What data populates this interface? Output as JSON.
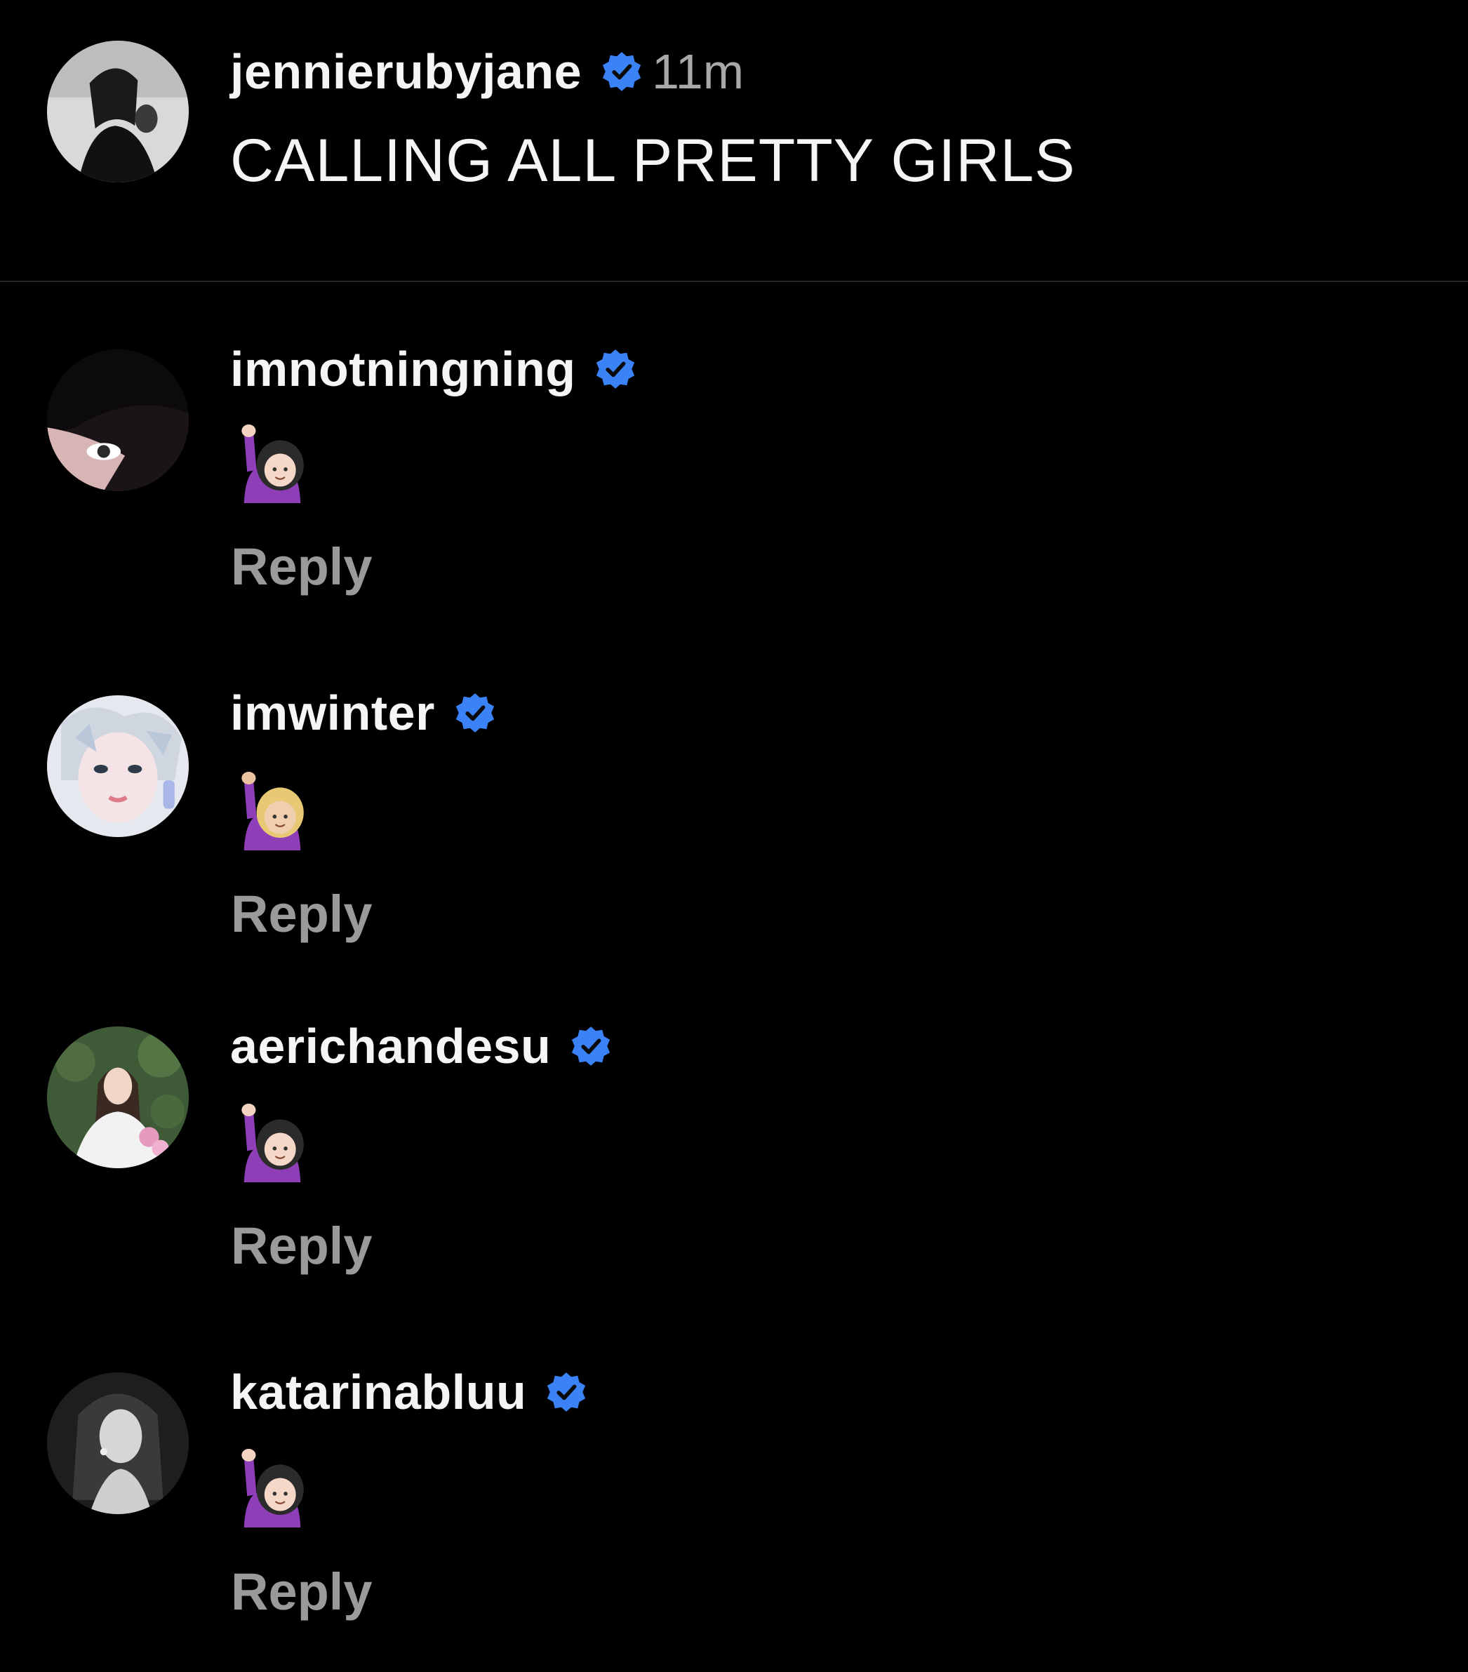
{
  "post": {
    "username": "jennierubyjane",
    "verified": true,
    "time": "11m",
    "caption": "CALLING ALL PRETTY GIRLS"
  },
  "comments": [
    {
      "username": "imnotningning",
      "verified": true,
      "emoji": "🙋🏻‍♀️",
      "emoji_icon": "woman-raising-hand-icon",
      "reply_label": "Reply"
    },
    {
      "username": "imwinter",
      "verified": true,
      "emoji": "🙋🏼‍♀️",
      "emoji_icon": "woman-raising-hand-icon",
      "reply_label": "Reply"
    },
    {
      "username": "aerichandesu",
      "verified": true,
      "emoji": "🙋🏻‍♀️",
      "emoji_icon": "woman-raising-hand-icon",
      "reply_label": "Reply"
    },
    {
      "username": "katarinabluu",
      "verified": true,
      "emoji": "🙋🏻‍♀️",
      "emoji_icon": "woman-raising-hand-icon",
      "reply_label": "Reply"
    }
  ],
  "colors": {
    "background": "#000000",
    "text": "#f5f5f5",
    "muted": "#a8a8a8",
    "reply": "#9a9a9a",
    "verified_badge": "#3b82f6",
    "divider": "#262626"
  }
}
